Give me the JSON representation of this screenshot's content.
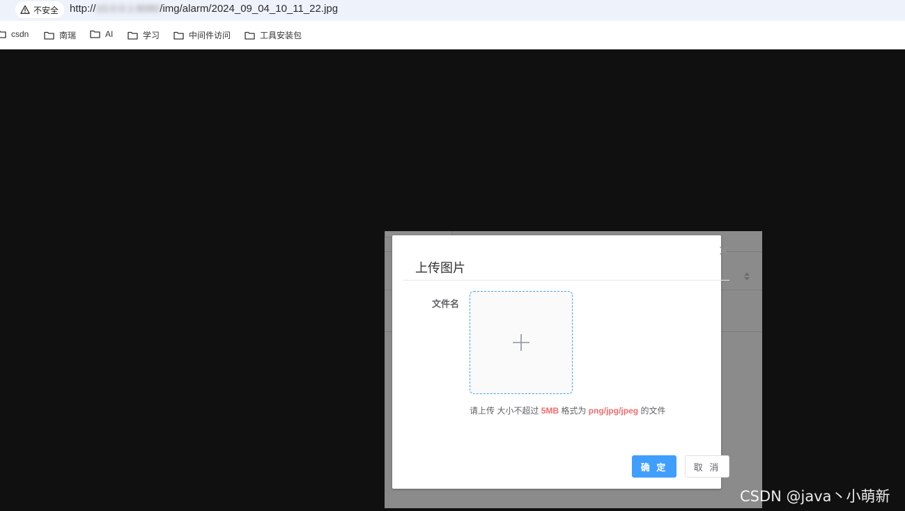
{
  "browser": {
    "security_label": "不安全",
    "url_prefix": "http://",
    "url_host_blurred": "10.0.0.1:8080",
    "url_path": "/img/alarm/2024_09_04_10_11_22.jpg",
    "bookmarks": [
      {
        "label": "csdn",
        "icon": "folder-icon"
      },
      {
        "label": "南瑞",
        "icon": "folder-icon"
      },
      {
        "label": "AI",
        "icon": "folder-icon"
      },
      {
        "label": "学习",
        "icon": "folder-icon"
      },
      {
        "label": "中间件访问",
        "icon": "folder-icon"
      },
      {
        "label": "工具安装包",
        "icon": "folder-icon"
      }
    ]
  },
  "dialog": {
    "title": "上传图片",
    "field_label": "文件名",
    "hint": {
      "prefix": "请上传",
      "size_text": "大小不超过",
      "size_value": "5MB",
      "format_text": "格式为",
      "format_value": "png/jpg/jpeg",
      "suffix": "的文件"
    },
    "confirm_label": "确 定",
    "cancel_label": "取 消"
  },
  "watermark": "CSDN @java丶小萌新",
  "colors": {
    "primary": "#409eff",
    "danger": "#f56c6c",
    "page_background": "#101010",
    "overlay_gray": "#8b8b8b"
  }
}
